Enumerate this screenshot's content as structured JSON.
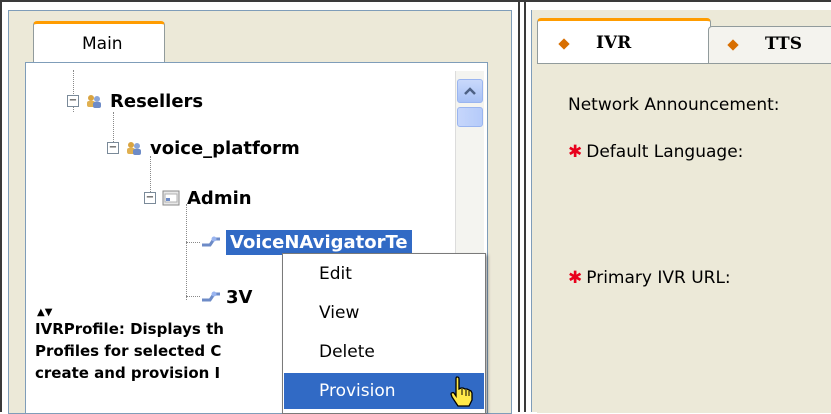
{
  "left_panel": {
    "tab_label": "Main",
    "tree": {
      "resellers": "Resellers",
      "voice_platform": "voice_platform",
      "admin": "Admin",
      "selected_item": "VoiceNAvigatorTe",
      "partial_item": "3V"
    },
    "description_lines": [
      "IVRProfile: Displays th",
      "Profiles for selected C",
      "create and provision I"
    ]
  },
  "context_menu": {
    "items": [
      "Edit",
      "View",
      "Delete",
      "Provision"
    ],
    "hovered": "Provision"
  },
  "right_panel": {
    "tabs": [
      "IVR",
      "TTS"
    ],
    "fields": {
      "network_announcement": "Network Announcement:",
      "default_language": "Default Language:",
      "primary_ivr_url": "Primary IVR URL:"
    },
    "required_marker": "✱"
  },
  "colors": {
    "selection": "#316ac5",
    "active_tab_accent": "#ff9c00",
    "required": "#e8001c",
    "panel_bg": "#ece9d8"
  }
}
